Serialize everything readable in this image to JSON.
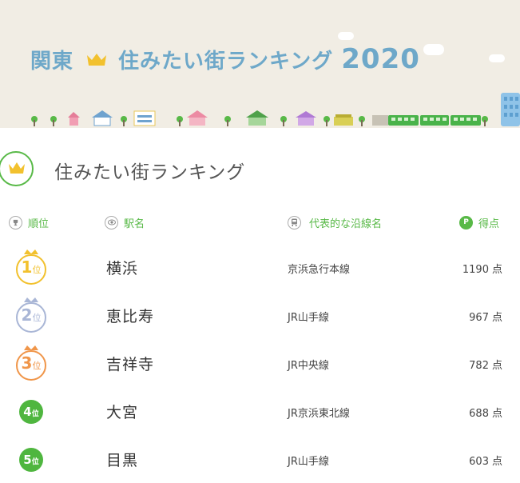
{
  "banner": {
    "region": "関東",
    "title": "住みたい街ランキング",
    "year": "2020"
  },
  "card": {
    "title": "住みたい街ランキング"
  },
  "columns": {
    "rank": "順位",
    "station": "駅名",
    "line": "代表的な沿線名",
    "score": "得点"
  },
  "rank_suffix": "位",
  "score_unit": "点",
  "rows": [
    {
      "rank": "1",
      "station": "横浜",
      "line": "京浜急行本線",
      "score": "1190"
    },
    {
      "rank": "2",
      "station": "恵比寿",
      "line": "JR山手線",
      "score": "967"
    },
    {
      "rank": "3",
      "station": "吉祥寺",
      "line": "JR中央線",
      "score": "782"
    },
    {
      "rank": "4",
      "station": "大宮",
      "line": "JR京浜東北線",
      "score": "688"
    },
    {
      "rank": "5",
      "station": "目黒",
      "line": "JR山手線",
      "score": "603"
    }
  ],
  "colors": {
    "accent_green": "#58b947",
    "title_blue": "#6ea8c9",
    "gold": "#f2c12e",
    "silver": "#a9b6d6",
    "bronze": "#f0964a",
    "banner_bg": "#f1ede4"
  },
  "icons": {
    "banner_crown": "crown-icon",
    "card_crown": "crown-icon",
    "rank_header": "trophy-icon",
    "station_header": "eye-icon",
    "line_header": "train-icon",
    "score_header": "points-icon"
  }
}
